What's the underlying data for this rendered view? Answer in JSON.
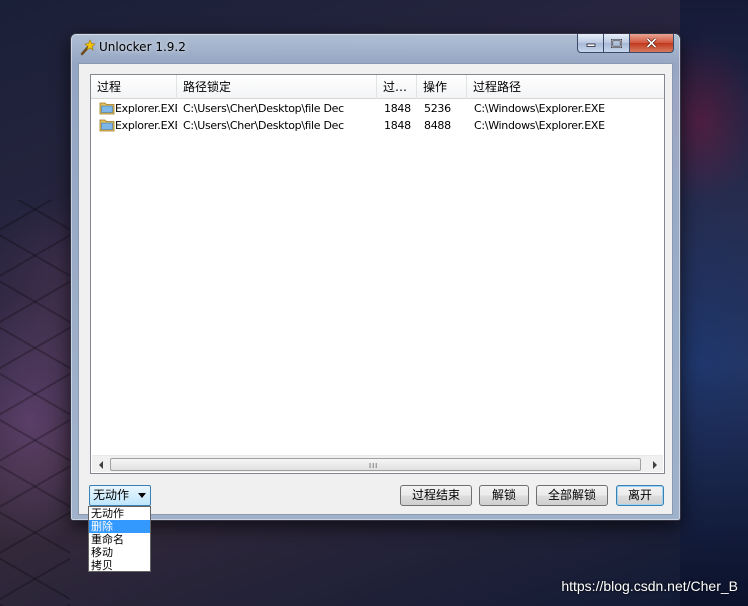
{
  "window": {
    "title": "Unlocker 1.9.2"
  },
  "listview": {
    "columns": [
      "过程",
      "路径锁定",
      "过…",
      "操作",
      "过程路径"
    ],
    "rows": [
      {
        "process": "Explorer.EXE",
        "path": "C:\\Users\\Cher\\Desktop\\file Dec",
        "pid": "1848",
        "handle": "5236",
        "process_path": "C:\\Windows\\Explorer.EXE"
      },
      {
        "process": "Explorer.EXE",
        "path": "C:\\Users\\Cher\\Desktop\\file Dec",
        "pid": "1848",
        "handle": "8488",
        "process_path": "C:\\Windows\\Explorer.EXE"
      }
    ],
    "scroll_grip": "III"
  },
  "action": {
    "selected": "无动作",
    "options": [
      "无动作",
      "删除",
      "重命名",
      "移动",
      "拷贝"
    ],
    "highlighted_index": 1
  },
  "buttons": {
    "kill_process": "过程结束",
    "unlock": "解锁",
    "unlock_all": "全部解锁",
    "quit": "离开"
  },
  "watermark": "https://blog.csdn.net/Cher_B",
  "colors": {
    "selection": "#3399ff",
    "close_button": "#c1381c"
  }
}
